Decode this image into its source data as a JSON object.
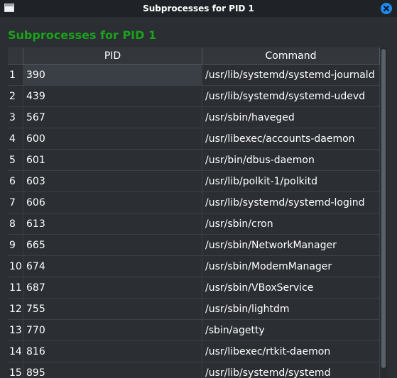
{
  "window": {
    "title": "Subprocesses for PID 1"
  },
  "heading": "Subprocesses for PID 1",
  "table": {
    "columns": [
      "PID",
      "Command"
    ],
    "rows": [
      {
        "num": "1",
        "pid": "390",
        "command": "/usr/lib/systemd/systemd-journald"
      },
      {
        "num": "2",
        "pid": "439",
        "command": "/usr/lib/systemd/systemd-udevd"
      },
      {
        "num": "3",
        "pid": "567",
        "command": "/usr/sbin/haveged"
      },
      {
        "num": "4",
        "pid": "600",
        "command": "/usr/libexec/accounts-daemon"
      },
      {
        "num": "5",
        "pid": "601",
        "command": "/usr/bin/dbus-daemon"
      },
      {
        "num": "6",
        "pid": "603",
        "command": "/usr/lib/polkit-1/polkitd"
      },
      {
        "num": "7",
        "pid": "606",
        "command": "/usr/lib/systemd/systemd-logind"
      },
      {
        "num": "8",
        "pid": "613",
        "command": "/usr/sbin/cron"
      },
      {
        "num": "9",
        "pid": "665",
        "command": "/usr/sbin/NetworkManager"
      },
      {
        "num": "10",
        "pid": "674",
        "command": "/usr/sbin/ModemManager"
      },
      {
        "num": "11",
        "pid": "687",
        "command": "/usr/sbin/VBoxService"
      },
      {
        "num": "12",
        "pid": "755",
        "command": "/usr/sbin/lightdm"
      },
      {
        "num": "13",
        "pid": "770",
        "command": "/sbin/agetty"
      },
      {
        "num": "14",
        "pid": "816",
        "command": "/usr/libexec/rtkit-daemon"
      },
      {
        "num": "15",
        "pid": "895",
        "command": "/usr/lib/systemd/systemd"
      }
    ]
  },
  "colors": {
    "heading": "#1aa31a",
    "close_button": "#1d8cf0"
  }
}
